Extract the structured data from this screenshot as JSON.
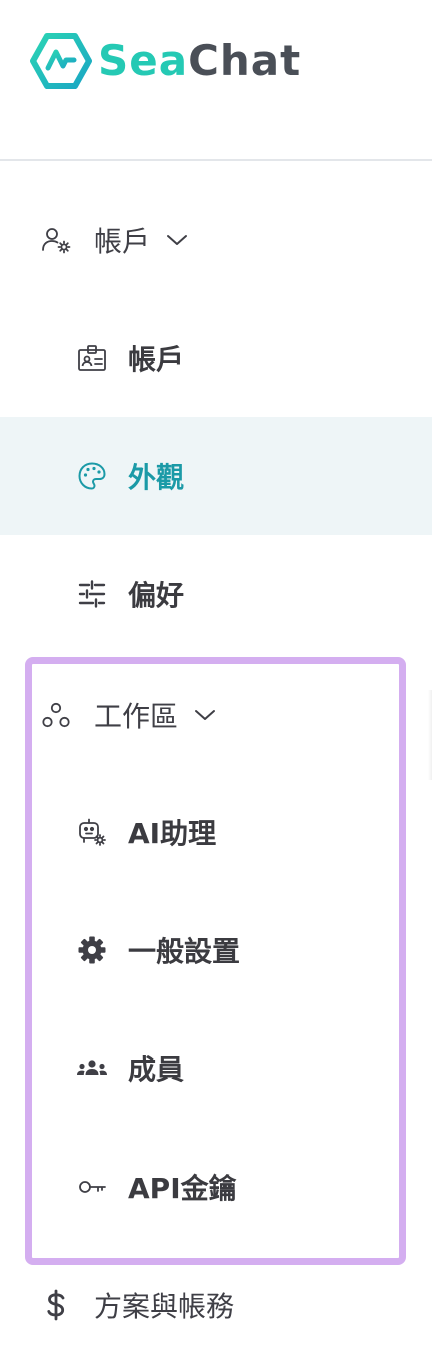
{
  "brand": {
    "name_part1": "Sea",
    "name_part2": "Chat",
    "accent": "#25c9b4"
  },
  "nav": {
    "account_group": {
      "label": "帳戶",
      "icon": "user-gear-icon",
      "expanded": true
    },
    "account_items": [
      {
        "label": "帳戶",
        "icon": "id-badge-icon",
        "active": false
      },
      {
        "label": "外觀",
        "icon": "palette-icon",
        "active": true
      },
      {
        "label": "偏好",
        "icon": "sliders-icon",
        "active": false
      }
    ],
    "workspace_group": {
      "label": "工作區",
      "icon": "workspace-nodes-icon",
      "expanded": true
    },
    "workspace_items": [
      {
        "label": "AI助理",
        "icon": "bot-gear-icon"
      },
      {
        "label": "一般設置",
        "icon": "gear-icon"
      },
      {
        "label": "成員",
        "icon": "members-icon"
      },
      {
        "label": "API金鑰",
        "icon": "key-icon"
      }
    ],
    "billing": {
      "label": "方案與帳務",
      "icon": "dollar-icon"
    }
  },
  "colors": {
    "active_bg": "#eef5f7",
    "active_text": "#1b9aa7",
    "highlight_border": "#d4aef0"
  }
}
